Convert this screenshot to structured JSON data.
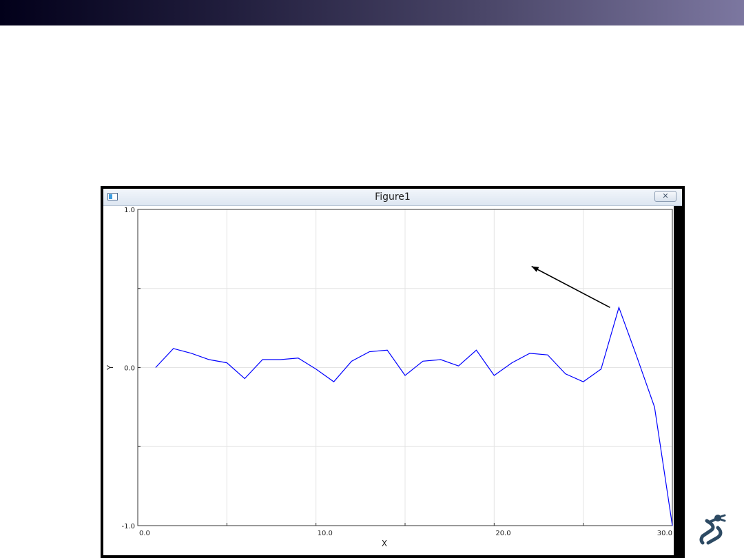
{
  "window": {
    "title": "Figure1",
    "close_glyph": "✕",
    "icon": "figure-window-icon"
  },
  "chart_data": {
    "type": "line",
    "xlabel": "X",
    "ylabel": "Y",
    "xlim": [
      0,
      30
    ],
    "ylim": [
      -1,
      1
    ],
    "xticks": [
      0,
      10,
      20,
      30
    ],
    "xtick_labels": [
      "0.0",
      "10.0",
      "20.0",
      "30.0"
    ],
    "yticks": [
      -1,
      0,
      1
    ],
    "ytick_labels": [
      "-1.0",
      "0.0",
      "1.0"
    ],
    "grid": true,
    "series": [
      {
        "color": "#0000ff",
        "x": [
          1,
          2,
          3,
          4,
          5,
          6,
          7,
          8,
          9,
          10,
          11,
          12,
          13,
          14,
          15,
          16,
          17,
          18,
          19,
          20,
          21,
          22,
          23,
          24,
          25,
          26,
          27,
          28,
          29,
          30
        ],
        "y": [
          0.0,
          0.12,
          0.09,
          0.05,
          0.03,
          -0.07,
          0.05,
          0.05,
          0.06,
          -0.01,
          -0.09,
          0.04,
          0.1,
          0.11,
          -0.05,
          0.04,
          0.05,
          0.01,
          0.11,
          -0.05,
          0.03,
          0.09,
          0.08,
          -0.04,
          -0.09,
          -0.01,
          0.38,
          0.07,
          -0.25,
          -1.0
        ]
      }
    ],
    "annotation": {
      "type": "arrow",
      "from": [
        26.5,
        0.38
      ],
      "to": [
        22.1,
        0.64
      ]
    }
  },
  "branding": {
    "logo_icon": "robot-arm-logo-icon",
    "topbar_colors": [
      "#02001a",
      "#7c77a0"
    ]
  }
}
